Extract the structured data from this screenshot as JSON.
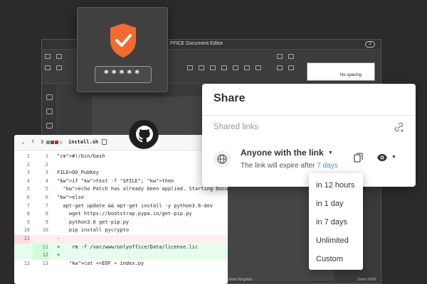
{
  "editor": {
    "title": "FFICE Document Editor",
    "badge": "2",
    "style_label": "No spacing",
    "status_language": "United Kingdom",
    "status_zoom": "Zoom 100%"
  },
  "password": {
    "masked": "*****"
  },
  "code": {
    "line_count": "3",
    "filename": "install.sh",
    "lines": [
      {
        "old": "1",
        "new": "1",
        "type": "ctx",
        "text": "#!/bin/bash"
      },
      {
        "old": "2",
        "new": "2",
        "type": "ctx",
        "text": ""
      },
      {
        "old": "3",
        "new": "3",
        "type": "ctx",
        "text": "FILE=OO_PubKey"
      },
      {
        "old": "4",
        "new": "4",
        "type": "ctx",
        "text": "if test -f \"$FILE\"; then"
      },
      {
        "old": "5",
        "new": "5",
        "type": "ctx",
        "text": "  echo Patch has already been applied. Starting Docum"
      },
      {
        "old": "6",
        "new": "6",
        "type": "ctx",
        "text": "else"
      },
      {
        "old": "7",
        "new": "7",
        "type": "ctx",
        "text": "  apt-get update && apt-get install -y python3.6-dev"
      },
      {
        "old": "8",
        "new": "8",
        "type": "ctx",
        "text": "    wget https://bootstrap.pypa.io/get-pip.py"
      },
      {
        "old": "9",
        "new": "9",
        "type": "ctx",
        "text": "    python3.6 get-pip.py"
      },
      {
        "old": "10",
        "new": "10",
        "type": "ctx",
        "text": "    pip install pycrypto"
      },
      {
        "old": "11",
        "new": "",
        "type": "del",
        "text": "-"
      },
      {
        "old": "",
        "new": "11",
        "type": "add",
        "text": "+    rm -f /var/www/onlyoffice/Data/license.lic"
      },
      {
        "old": "",
        "new": "12",
        "type": "add",
        "text": "+"
      },
      {
        "old": "12",
        "new": "13",
        "type": "ctx",
        "text": "    cat <<EOF > index.py"
      }
    ]
  },
  "share": {
    "title": "Share",
    "shared_links_label": "Shared links",
    "access_label": "Anyone with the link",
    "expire_prefix": "The link will expire after",
    "expire_value": "7 days"
  },
  "dropdown": {
    "options": [
      "in 12 hours",
      "in 1 day",
      "in 7 days",
      "Unlimited",
      "Custom"
    ]
  },
  "colors": {
    "shield": "#f26a2e",
    "link": "#4a90d9",
    "diff_add": "#e6ffed",
    "diff_del": "#ffeef0"
  }
}
